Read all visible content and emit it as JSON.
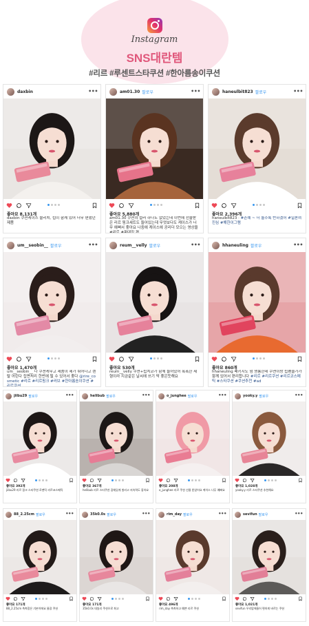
{
  "header": {
    "brand": "Instagram",
    "title": "SNS대란템",
    "hashtags": "#리르 #루센트스타쿠션 #한아름송이쿠션",
    "brand_colors": {
      "accent": "#e0577b",
      "blob": "#fbe3ea"
    }
  },
  "follow_label": "팔로우",
  "posts": [
    {
      "username": "daxbin",
      "follow": "",
      "likes": "좋아요 8,131개",
      "caption": "daxbin 쿠션케이스 블리치, 립이 함께 있어 너무 편했던 제품",
      "hashtags": "",
      "photo": {
        "bg": "#e9e6e3",
        "hair": "#1c1716",
        "top": "#f4f1ee",
        "prop": "#e98a9b"
      }
    },
    {
      "username": "am01.30",
      "follow": "팔로우",
      "likes": "좋아요 5,880개",
      "caption": "am01.30 쿠션의 컬러 하나도 없었는데 이번에 선물받은 리르 핑크세트도 들어있는데 무엇보다도 케이스가 너무 예뻐서 좋아요 나중에 케이스에 공리더 모으는 영상을 #리르 #파데킹 편",
      "hashtags": "",
      "photo": {
        "bg": "#3a2a22",
        "hair": "#5a3421",
        "top": "#a5633b",
        "prop": "#e6738a"
      }
    },
    {
      "username": "haneulbit823",
      "follow": "팔로우",
      "likes": "좋아요 2,396개",
      "caption": "haneulbit823 ·",
      "hashtags": "#존예 ~ 너 돌수록 반하겠어 #일본여 진심 #해한이그램",
      "photo": {
        "bg": "#e4ddd6",
        "hair": "#5b3b2c",
        "top": "#ffffff",
        "prop": "#e7819b"
      }
    },
    {
      "username": "um__seobin__",
      "follow": "팔로우",
      "likes": "좋아요 1,470개",
      "caption": "um__seobin__ 나 쿠션케무고 제품이 제가 뛰어나고 렌탈 어린다 집면처리 한번에 될 수 있어서 좋다",
      "hashtags": "@rire_cosmetic #리르 #리르핑크 #러브 #한아름송이쿠션 #리르쿠션",
      "photo": {
        "bg": "#f1ecec",
        "hair": "#2a1d1a",
        "top": "#f2eeee",
        "prop": "#e38aa6"
      }
    },
    {
      "username": "reum__velly",
      "follow": "팔로우",
      "likes": "좋아요 530개",
      "caption": "reum__velly 쿠션+립치코가 함께 들어있어 폭폭한 제형이라 지금같은 날씨에 쓰기 딱 좋은듯해요",
      "hashtags": "",
      "photo": {
        "bg": "#e8e4e4",
        "hair": "#171313",
        "top": "#222222",
        "prop": "#e6829b"
      }
    },
    {
      "username": "hhaneuling",
      "follow": "팔로우",
      "likes": "좋아요 860개",
      "caption": "hhaneuling 패키지도 넘 영롱한데 쿠션이랑 립펜슬가가 함께 있어서 편리합니다",
      "hashtags": "#리르 #리르쿠션 #리르코스메틱 #스타쿠션 #쿠션추천 #ad",
      "photo": {
        "bg": "#e6a5a8",
        "hair": "#5a3a2d",
        "top": "#e86a30",
        "prop": "#e1445e"
      }
    },
    {
      "username": "jiibu29",
      "follow": "팔로우",
      "likes": "좋아요 392개",
      "caption": "jiibu29 리르 핑크 스타쿠션 로맨틱 리르코스메틱",
      "hashtags": "",
      "photo": {
        "bg": "#ece9e8",
        "hair": "#1d1716",
        "top": "#ffffff",
        "prop": "#e88aa0"
      }
    },
    {
      "username": "helibub",
      "follow": "팔로우",
      "likes": "좋아요 367개",
      "caption": "helibub 리르 스타쿠션 광채있게 발리고 지속력도 좋아요",
      "hashtags": "",
      "photo": {
        "bg": "#b9b2ae",
        "hair": "#1c1716",
        "top": "#d9d6d4",
        "prop": "#e77c95"
      }
    },
    {
      "username": "o_junghee",
      "follow": "팔로우",
      "likes": "좋아요 208개",
      "caption": "o_junghee 리르 쿠션 선물 받았어요 케이스 너무 예뻐요",
      "hashtags": "",
      "photo": {
        "bg": "#f1e6e6",
        "hair": "#f09aa6",
        "top": "#f5f0f0",
        "prop": "#e97c93"
      }
    },
    {
      "username": "yooky.y",
      "follow": "팔로우",
      "likes": "좋아요 1,028개",
      "caption": "yooky.y 리르 스타쿠션 추천해요",
      "hashtags": "",
      "photo": {
        "bg": "#f0eceb",
        "hair": "#8a5a3e",
        "top": "#2a2727",
        "prop": "#e78496"
      }
    },
    {
      "username": "88_2.25cm",
      "follow": "팔로우",
      "likes": "좋아요 171개",
      "caption": "88_2.25cm 촉촉함은 기본이에요 물광 쿠션",
      "hashtags": "",
      "photo": {
        "bg": "#ece8e6",
        "hair": "#221a18",
        "top": "#1e1b1b",
        "prop": "#e98a9c"
      }
    },
    {
      "username": "35k0.0s",
      "follow": "팔로우",
      "likes": "좋아요 171개",
      "caption": "35k0.0s 데일리 쿠션으로 최고",
      "hashtags": "",
      "photo": {
        "bg": "#dcd6d3",
        "hair": "#1f1715",
        "top": "#e9e6e5",
        "prop": "#e7879c"
      }
    },
    {
      "username": "rim_day",
      "follow": "팔로우",
      "likes": "좋아요 496개",
      "caption": "rim_day 촉촉하고 예쁜 리르 쿠션",
      "hashtags": "",
      "photo": {
        "bg": "#efe8e6",
        "hair": "#5a3a2d",
        "top": "#f3efee",
        "prop": "#e4809a"
      }
    },
    {
      "username": "sevifun",
      "follow": "팔로우",
      "likes": "좋아요 1,021개",
      "caption": "sevifun 우리맘에들어 편하게 바르는 쿠션",
      "hashtags": "",
      "photo": {
        "bg": "#e5e1de",
        "hair": "#2a1f1b",
        "top": "#5c5a58",
        "prop": "#e27e97"
      }
    }
  ]
}
